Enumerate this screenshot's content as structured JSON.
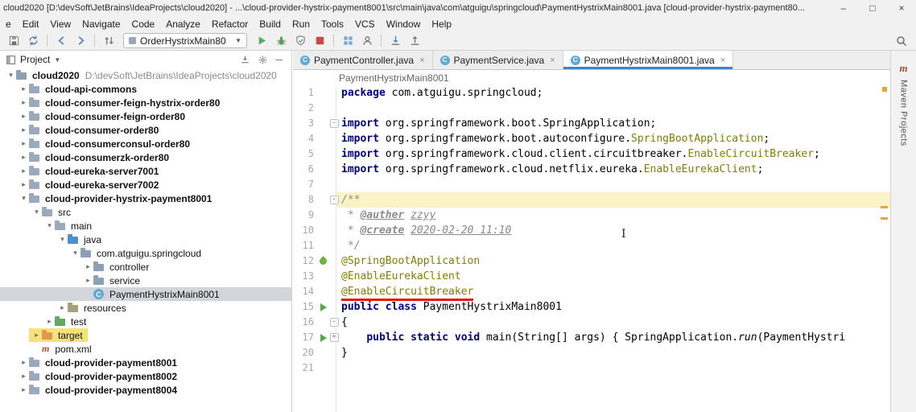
{
  "title_bar": {
    "title": "cloud2020 [D:\\devSoft\\JetBrains\\IdeaProjects\\cloud2020] - ...\\cloud-provider-hystrix-payment8001\\src\\main\\java\\com\\atguigu\\springcloud\\PaymentHystrixMain8001.java [cloud-provider-hystrix-payment80...",
    "minimize": "–",
    "maximize": "□",
    "close": "×"
  },
  "menu_bar": {
    "items": [
      "e",
      "Edit",
      "View",
      "Navigate",
      "Code",
      "Analyze",
      "Refactor",
      "Build",
      "Run",
      "Tools",
      "VCS",
      "Window",
      "Help"
    ]
  },
  "toolbar": {
    "run_config": "OrderHystrixMain80",
    "icons": [
      "save-all",
      "synchronize",
      "back",
      "forward",
      "navigate-up-down",
      "run",
      "debug",
      "run-with-coverage",
      "stop",
      "run-dashboard",
      "profiler",
      "vcs-update",
      "vcs-commit",
      "search-everywhere"
    ]
  },
  "project_panel": {
    "header": {
      "title": "Project",
      "icons": [
        "collapse-all",
        "settings-gear",
        "hide-panel"
      ]
    },
    "tree": [
      {
        "level": 0,
        "chevron": "expanded",
        "icon": "project",
        "label": "cloud2020",
        "sublabel": "D:\\devSoft\\JetBrains\\IdeaProjects\\cloud2020",
        "bold": true
      },
      {
        "level": 1,
        "chevron": "collapsed",
        "icon": "module",
        "label": "cloud-api-commons",
        "bold": true
      },
      {
        "level": 1,
        "chevron": "collapsed",
        "icon": "module",
        "label": "cloud-consumer-feign-hystrix-order80",
        "bold": true
      },
      {
        "level": 1,
        "chevron": "collapsed",
        "icon": "module",
        "label": "cloud-consumer-feign-order80",
        "bold": true
      },
      {
        "level": 1,
        "chevron": "collapsed",
        "icon": "module",
        "label": "cloud-consumer-order80",
        "bold": true
      },
      {
        "level": 1,
        "chevron": "collapsed",
        "icon": "module",
        "label": "cloud-consumerconsul-order80",
        "bold": true
      },
      {
        "level": 1,
        "chevron": "collapsed",
        "icon": "module",
        "label": "cloud-consumerzk-order80",
        "bold": true
      },
      {
        "level": 1,
        "chevron": "collapsed",
        "icon": "module",
        "label": "cloud-eureka-server7001",
        "bold": true
      },
      {
        "level": 1,
        "chevron": "collapsed",
        "icon": "module",
        "label": "cloud-eureka-server7002",
        "bold": true
      },
      {
        "level": 1,
        "chevron": "expanded",
        "icon": "module",
        "label": "cloud-provider-hystrix-payment8001",
        "bold": true
      },
      {
        "level": 2,
        "chevron": "expanded",
        "icon": "dir",
        "label": "src"
      },
      {
        "level": 3,
        "chevron": "expanded",
        "icon": "dir",
        "label": "main"
      },
      {
        "level": 4,
        "chevron": "expanded",
        "icon": "source",
        "label": "java"
      },
      {
        "level": 5,
        "chevron": "expanded",
        "icon": "package",
        "label": "com.atguigu.springcloud"
      },
      {
        "level": 6,
        "chevron": "collapsed",
        "icon": "package",
        "label": "controller"
      },
      {
        "level": 6,
        "chevron": "collapsed",
        "icon": "package",
        "label": "service"
      },
      {
        "level": 6,
        "chevron": "",
        "icon": "class",
        "label": "PaymentHystrixMain8001",
        "selected": true
      },
      {
        "level": 4,
        "chevron": "collapsed",
        "icon": "resources",
        "label": "resources"
      },
      {
        "level": 3,
        "chevron": "collapsed",
        "icon": "test",
        "label": "test"
      },
      {
        "level": 2,
        "chevron": "collapsed",
        "icon": "excluded",
        "label": "target",
        "highlight": true
      },
      {
        "level": 2,
        "chevron": "",
        "icon": "maven",
        "label": "pom.xml"
      },
      {
        "level": 1,
        "chevron": "collapsed",
        "icon": "module",
        "label": "cloud-provider-payment8001",
        "bold": true
      },
      {
        "level": 1,
        "chevron": "collapsed",
        "icon": "module",
        "label": "cloud-provider-payment8002",
        "bold": true
      },
      {
        "level": 1,
        "chevron": "collapsed",
        "icon": "module",
        "label": "cloud-provider-payment8004",
        "bold": true
      }
    ]
  },
  "editor": {
    "tabs": [
      {
        "label": "PaymentController.java",
        "close": "×"
      },
      {
        "label": "PaymentService.java",
        "close": "×"
      },
      {
        "label": "PaymentHystrixMain8001.java",
        "close": "×",
        "active": true
      }
    ],
    "breadcrumb": "PaymentHystrixMain8001",
    "code": {
      "lines": [
        {
          "n": "1",
          "t": [
            [
              "kw",
              "package"
            ],
            [
              "pl",
              " com.atguigu.springcloud;"
            ]
          ]
        },
        {
          "n": "2",
          "t": []
        },
        {
          "n": "3",
          "f": "-",
          "t": [
            [
              "kw",
              "import"
            ],
            [
              "pl",
              " org.springframework.boot.SpringApplication;"
            ]
          ]
        },
        {
          "n": "4",
          "t": [
            [
              "kw",
              "import"
            ],
            [
              "pl",
              " org.springframework.boot.autoconfigure."
            ],
            [
              "an",
              "SpringBootApplication"
            ],
            [
              "pl",
              ";"
            ]
          ]
        },
        {
          "n": "5",
          "t": [
            [
              "kw",
              "import"
            ],
            [
              "pl",
              " org.springframework.cloud.client.circuitbreaker."
            ],
            [
              "an",
              "EnableCircuitBreaker"
            ],
            [
              "pl",
              ";"
            ]
          ]
        },
        {
          "n": "6",
          "t": [
            [
              "kw",
              "import"
            ],
            [
              "pl",
              " org.springframework.cloud.netflix.eureka."
            ],
            [
              "an",
              "EnableEurekaClient"
            ],
            [
              "pl",
              ";"
            ]
          ]
        },
        {
          "n": "7",
          "t": []
        },
        {
          "n": "8",
          "f": "-",
          "hl": true,
          "t": [
            [
              "doc",
              "/**"
            ]
          ]
        },
        {
          "n": "9",
          "t": [
            [
              "doc",
              " * "
            ],
            [
              "dt",
              "@auther"
            ],
            [
              "doc",
              " "
            ],
            [
              "dv",
              "zzyy"
            ]
          ]
        },
        {
          "n": "10",
          "t": [
            [
              "doc",
              " * "
            ],
            [
              "dt",
              "@create"
            ],
            [
              "doc",
              " "
            ],
            [
              "dv",
              "2020-02-20 11:10"
            ]
          ]
        },
        {
          "n": "11",
          "t": [
            [
              "doc",
              " */"
            ]
          ]
        },
        {
          "n": "12",
          "g": "spring",
          "t": [
            [
              "an",
              "@SpringBootApplication"
            ]
          ]
        },
        {
          "n": "13",
          "t": [
            [
              "an",
              "@EnableEurekaClient"
            ]
          ]
        },
        {
          "n": "14",
          "t": [
            [
              "anr",
              "@EnableCircuitBreaker"
            ]
          ]
        },
        {
          "n": "15",
          "g": "run",
          "t": [
            [
              "kw",
              "public class"
            ],
            [
              "pl",
              " PaymentHystrixMain8001"
            ]
          ]
        },
        {
          "n": "16",
          "f": "-",
          "t": [
            [
              "pl",
              "{"
            ]
          ]
        },
        {
          "n": "17",
          "g": "run",
          "f": "+",
          "t": [
            [
              "pl",
              "    "
            ],
            [
              "kw",
              "public static void"
            ],
            [
              "pl",
              " main(String[] args) { SpringApplication."
            ],
            [
              "mi",
              "run"
            ],
            [
              "pl",
              "(PaymentHystri"
            ]
          ]
        },
        {
          "n": "20",
          "t": [
            [
              "pl",
              "}"
            ]
          ]
        },
        {
          "n": "21",
          "t": []
        }
      ]
    }
  },
  "right_bar": {
    "maven_m": "m",
    "label": "Maven Projects"
  },
  "colors": {
    "keyword": "#000080",
    "annotation": "#808000",
    "doc_comment": "#8C8C8C",
    "current_line": "#FBF3C6",
    "red_underline": "#E3170D",
    "tree_selection": "#D2D6DB",
    "target_highlight": "#F6E27A",
    "run_green": "#57A64A",
    "stop_red": "#C94A43",
    "warning_stripe": "#E8A33D"
  }
}
